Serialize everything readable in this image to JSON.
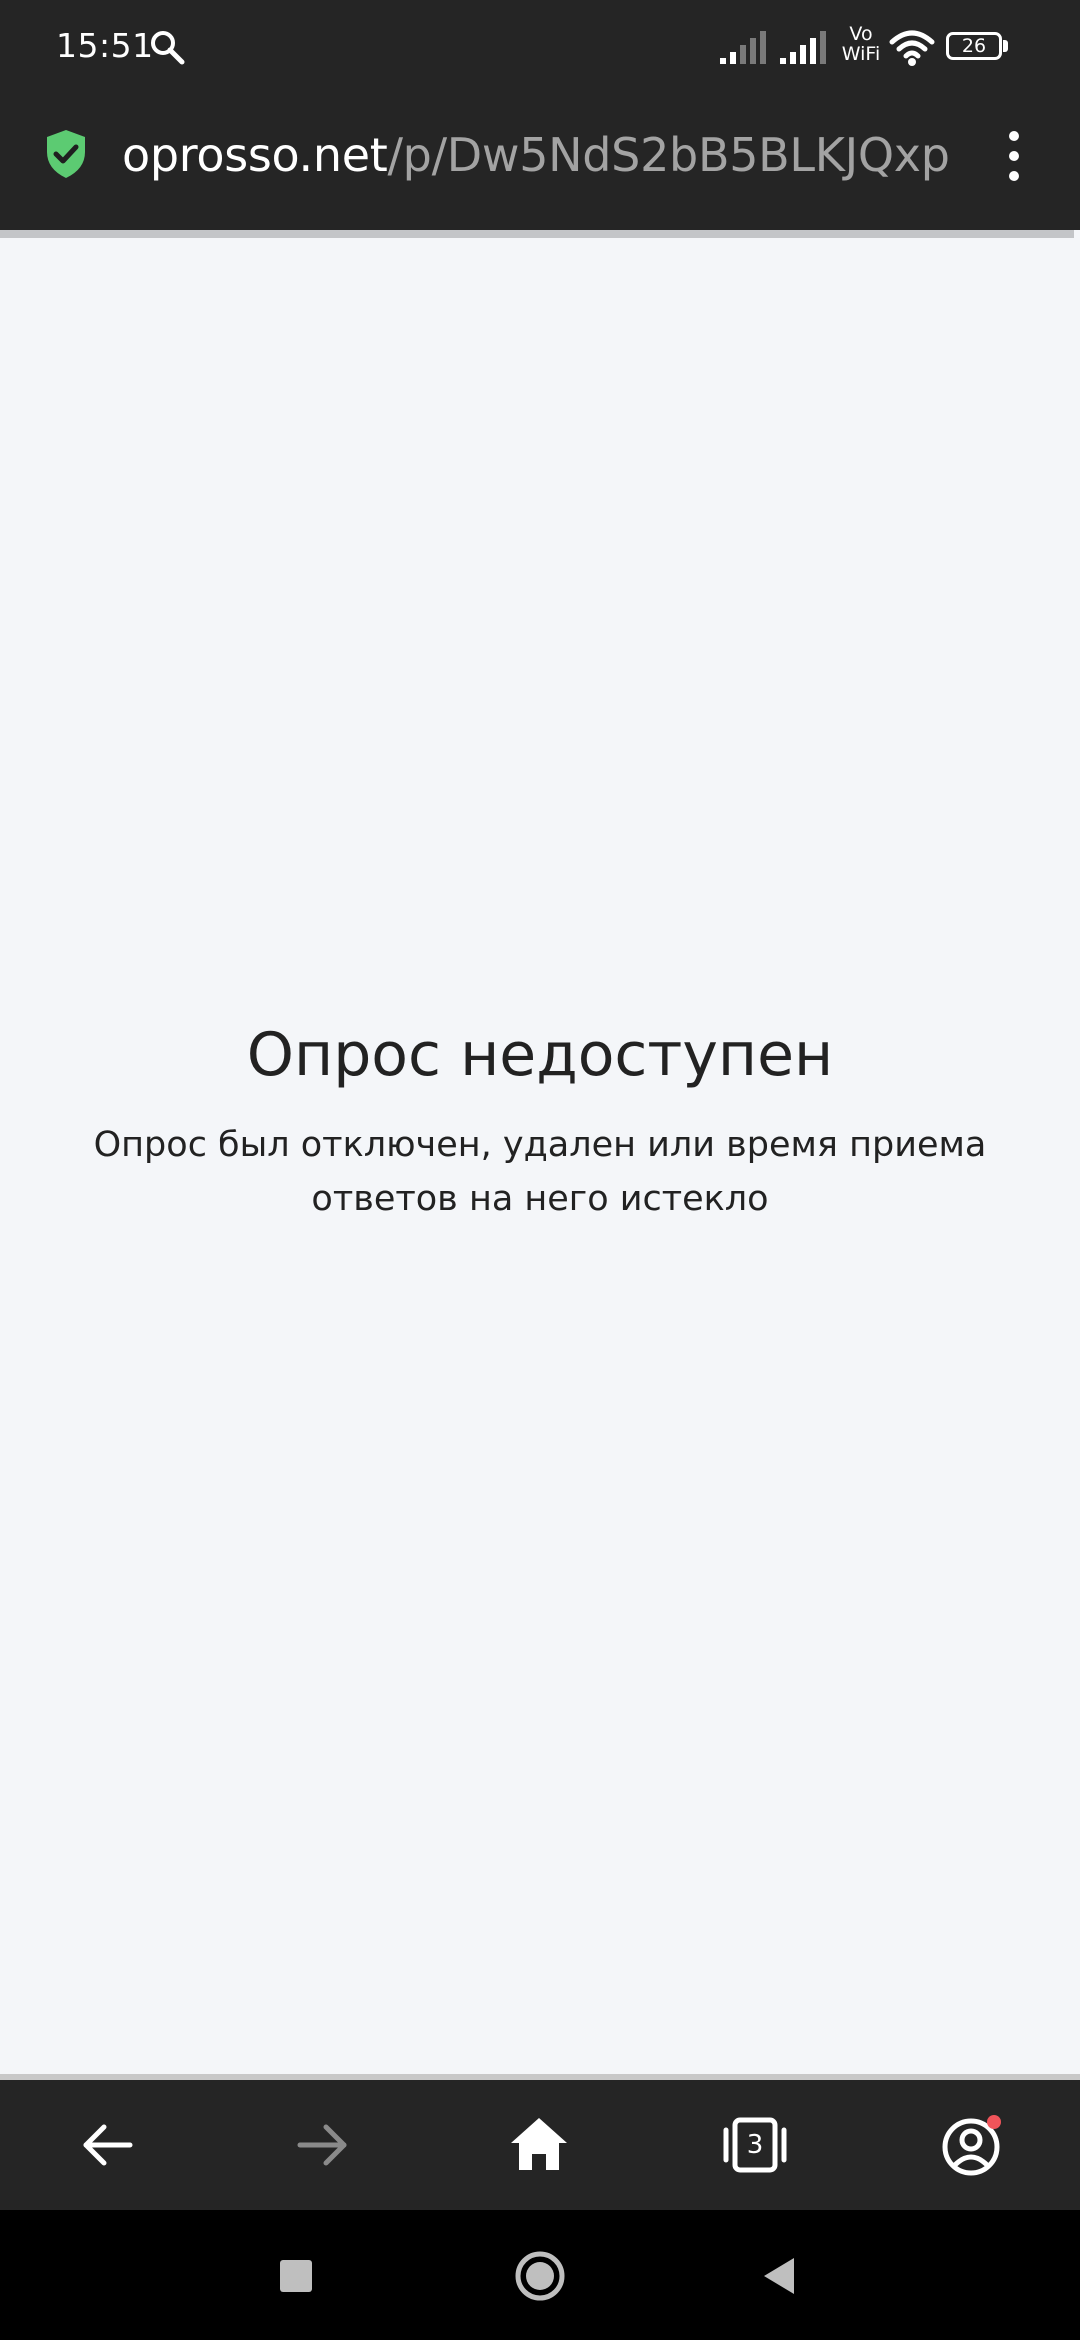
{
  "status_bar": {
    "time": "15:51",
    "vowifi_top": "Vo",
    "vowifi_bottom": "WiFi",
    "battery_level": "26"
  },
  "browser": {
    "url_domain": "oprosso.net",
    "url_path": "/p/Dw5NdS2bB5BLKJQxp"
  },
  "page": {
    "title": "Опрос недоступен",
    "message": "Опрос был отключен, удален или время приема ответов на него истекло"
  },
  "bottom_nav": {
    "tabs_count": "3"
  },
  "colors": {
    "toolbar_bg": "#252525",
    "page_bg": "#f4f6f9",
    "shield_green": "#5ccb72",
    "notification_dot": "#f0545a",
    "forward_disabled": "#8a8a8a"
  }
}
